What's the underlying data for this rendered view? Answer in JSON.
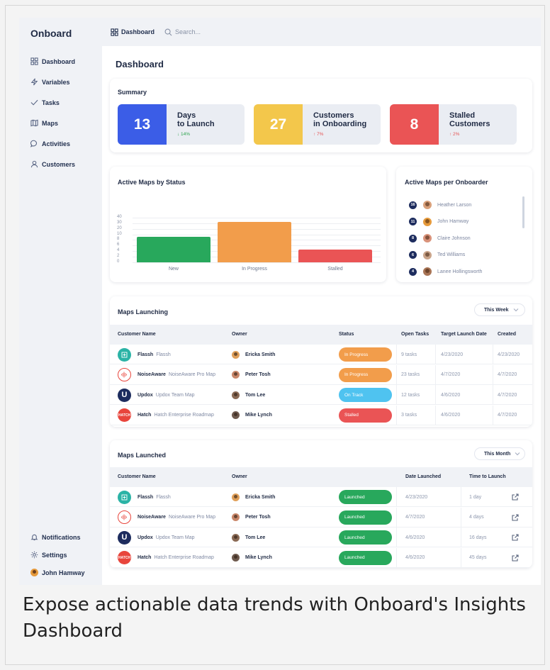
{
  "app": {
    "logo": "Onboard"
  },
  "sidebar": {
    "items": [
      {
        "label": "Dashboard",
        "icon": "grid-icon"
      },
      {
        "label": "Variables",
        "icon": "bolt-icon"
      },
      {
        "label": "Tasks",
        "icon": "check-icon"
      },
      {
        "label": "Maps",
        "icon": "map-icon"
      },
      {
        "label": "Activities",
        "icon": "chat-bubble-icon"
      },
      {
        "label": "Customers",
        "icon": "user-icon"
      }
    ],
    "bottom": [
      {
        "label": "Notifications",
        "icon": "bell-icon"
      },
      {
        "label": "Settings",
        "icon": "gear-icon"
      },
      {
        "label": "John Hamway",
        "icon": "avatar"
      }
    ]
  },
  "topbar": {
    "dashboard_label": "Dashboard",
    "search_placeholder": "Search..."
  },
  "page": {
    "title": "Dashboard"
  },
  "summary": {
    "title": "Summary",
    "cards": [
      {
        "value": "13",
        "line1": "Days",
        "line2": "to Launch",
        "change": "↓ 14%",
        "color": "#3b5de7",
        "change_color": "#2ea44f"
      },
      {
        "value": "27",
        "line1": "Customers",
        "line2": "in Onboarding",
        "change": "↑ 7%",
        "color": "#f3c74b",
        "change_color": "#e55353"
      },
      {
        "value": "8",
        "line1": "Stalled",
        "line2": "Customers",
        "change": "↑ 2%",
        "color": "#ea5455",
        "change_color": "#e55353"
      }
    ]
  },
  "chart_data": {
    "type": "bar",
    "title": "Active Maps by Status",
    "categories": [
      "New",
      "In Progress",
      "Stalled"
    ],
    "values": [
      9,
      32,
      4.5
    ],
    "colors": [
      "#28a85c",
      "#f29d4b",
      "#ea5455"
    ],
    "y_ticks": [
      "40",
      "30",
      "20",
      "10",
      "8",
      "6",
      "4",
      "2",
      "0"
    ],
    "grid": true
  },
  "onboarders": {
    "title": "Active Maps per Onboarder",
    "items": [
      {
        "count": "16",
        "name": "Heather Larson",
        "avatar_color": "#d9a07a"
      },
      {
        "count": "11",
        "name": "John Hamway",
        "avatar_color": "#e69a3b"
      },
      {
        "count": "8",
        "name": "Claire Johnson",
        "avatar_color": "#d9927a"
      },
      {
        "count": "6",
        "name": "Ted Williams",
        "avatar_color": "#c9a48a"
      },
      {
        "count": "4",
        "name": "Lanee Hollingsworth",
        "avatar_color": "#a87455"
      }
    ]
  },
  "launching": {
    "title": "Maps Launching",
    "filter": "This Week",
    "columns": [
      "Customer Name",
      "Owner",
      "Status",
      "Open Tasks",
      "Target Launch Date",
      "Created"
    ],
    "rows": [
      {
        "name": "Flassh",
        "map": "Flassh",
        "owner": "Ericka Smith",
        "status": "In Progress",
        "status_color": "#f29d4b",
        "tasks": "9 tasks",
        "target": "4/23/2020",
        "created": "4/23/2020",
        "logo_color": "#2bb3a6",
        "logo_text": "",
        "owner_color": "#e0a05a"
      },
      {
        "name": "NoiseAware",
        "map": "NoiseAware Pro Map",
        "owner": "Peter Tosh",
        "status": "In Progress",
        "status_color": "#f29d4b",
        "tasks": "23 tasks",
        "target": "4/7/2020",
        "created": "4/7/2020",
        "logo_color": "#ffffff",
        "logo_text": "",
        "owner_color": "#c9876a"
      },
      {
        "name": "Updox",
        "map": "Updox Team Map",
        "owner": "Tom Lee",
        "status": "On Track",
        "status_color": "#4fc3f0",
        "tasks": "12 tasks",
        "target": "4/6/2020",
        "created": "4/7/2020",
        "logo_color": "#1d2c5e",
        "logo_text": "U",
        "owner_color": "#8a6a55"
      },
      {
        "name": "Hatch",
        "map": "Hatch Enterprise Roadmap",
        "owner": "Mike Lynch",
        "status": "Stalled",
        "status_color": "#ea5455",
        "tasks": "3 tasks",
        "target": "4/6/2020",
        "created": "4/7/2020",
        "logo_color": "#e8453c",
        "logo_text": "HATCH",
        "owner_color": "#6e5a4e"
      }
    ]
  },
  "launched": {
    "title": "Maps Launched",
    "filter": "This Month",
    "columns": [
      "Customer Name",
      "Owner",
      "Date Launched",
      "Time to Launch"
    ],
    "rows": [
      {
        "name": "Flassh",
        "map": "Flassh",
        "owner": "Ericka Smith",
        "status": "Launched",
        "date": "4/23/2020",
        "time": "1 day"
      },
      {
        "name": "NoiseAware",
        "map": "NoiseAware Pro Map",
        "owner": "Peter Tosh",
        "status": "Launched",
        "date": "4/7/2020",
        "time": "4 days"
      },
      {
        "name": "Updox",
        "map": "Updox Team Map",
        "owner": "Tom Lee",
        "status": "Launched",
        "date": "4/6/2020",
        "time": "16 days"
      },
      {
        "name": "Hatch",
        "map": "Hatch Enterprise Roadmap",
        "owner": "Mike Lynch",
        "status": "Launched",
        "date": "4/6/2020",
        "time": "45 days"
      }
    ],
    "status_color": "#28a85c"
  },
  "caption": "Expose actionable data trends with Onboard's Insights Dashboard"
}
